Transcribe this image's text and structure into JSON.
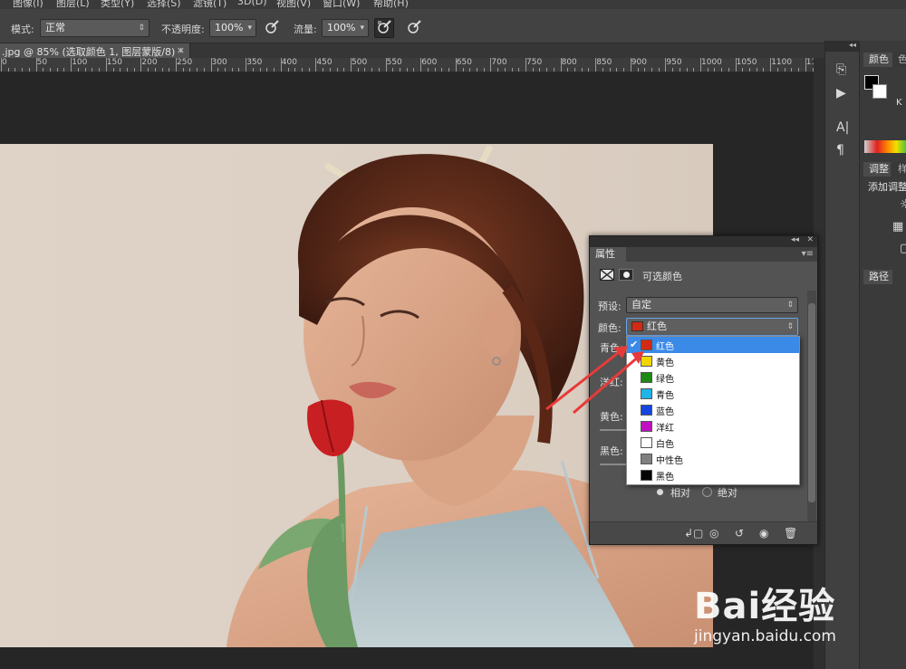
{
  "menubar": {
    "items": [
      "图像(I)",
      "图层(L)",
      "类型(Y)",
      "选择(S)",
      "滤镜(T)",
      "3D(D)",
      "视图(V)",
      "窗口(W)",
      "帮助(H)"
    ]
  },
  "options": {
    "mode_label": "模式:",
    "mode_value": "正常",
    "opacity_label": "不透明度:",
    "opacity_value": "100%",
    "flow_label": "流量:",
    "flow_value": "100%"
  },
  "document": {
    "tab_title": ".jpg @ 85% (选取颜色 1, 图层蒙版/8) *",
    "close": "×"
  },
  "ruler": {
    "ticks": [
      "0",
      "50",
      "100",
      "150",
      "200",
      "250",
      "300",
      "350",
      "400",
      "450",
      "500",
      "550",
      "600",
      "650",
      "700",
      "750",
      "800",
      "850",
      "900",
      "950",
      "1000",
      "1050",
      "1100",
      "115"
    ]
  },
  "right_panel": {
    "tab_color": "颜色",
    "tab_swatch": "色",
    "k_label": "K",
    "tab_adjust": "调整",
    "tab_styles": "样",
    "add_adjust": "添加调整",
    "tab_paths": "路径"
  },
  "properties": {
    "title": "属性",
    "layer_name": "可选颜色",
    "preset_label": "预设:",
    "preset_value": "自定",
    "colors_label": "颜色:",
    "colors_value": "红色",
    "cyan_label": "青色:",
    "magenta_label": "洋红:",
    "yellow_label": "黄色:",
    "black_label": "黑色:",
    "relative_label": "相对",
    "absolute_label": "绝对"
  },
  "color_list": {
    "items": [
      {
        "name": "红色",
        "swatch": "#d42a14",
        "selected": true
      },
      {
        "name": "黄色",
        "swatch": "#f2d600"
      },
      {
        "name": "绿色",
        "swatch": "#1e8a14"
      },
      {
        "name": "青色",
        "swatch": "#1eb4e8"
      },
      {
        "name": "蓝色",
        "swatch": "#1546e0"
      },
      {
        "name": "洋红",
        "swatch": "#c010c0"
      },
      {
        "name": "白色",
        "swatch": "#ffffff"
      },
      {
        "name": "中性色",
        "swatch": "#808080"
      },
      {
        "name": "黑色",
        "swatch": "#050505"
      }
    ]
  },
  "watermark": {
    "brand": "Bai经验",
    "url": "jingyan.baidu.com"
  },
  "colors": {
    "selection_blue": "#3b8ae8",
    "annotation_red": "#e83a3a",
    "panel_bg": "#535353"
  }
}
